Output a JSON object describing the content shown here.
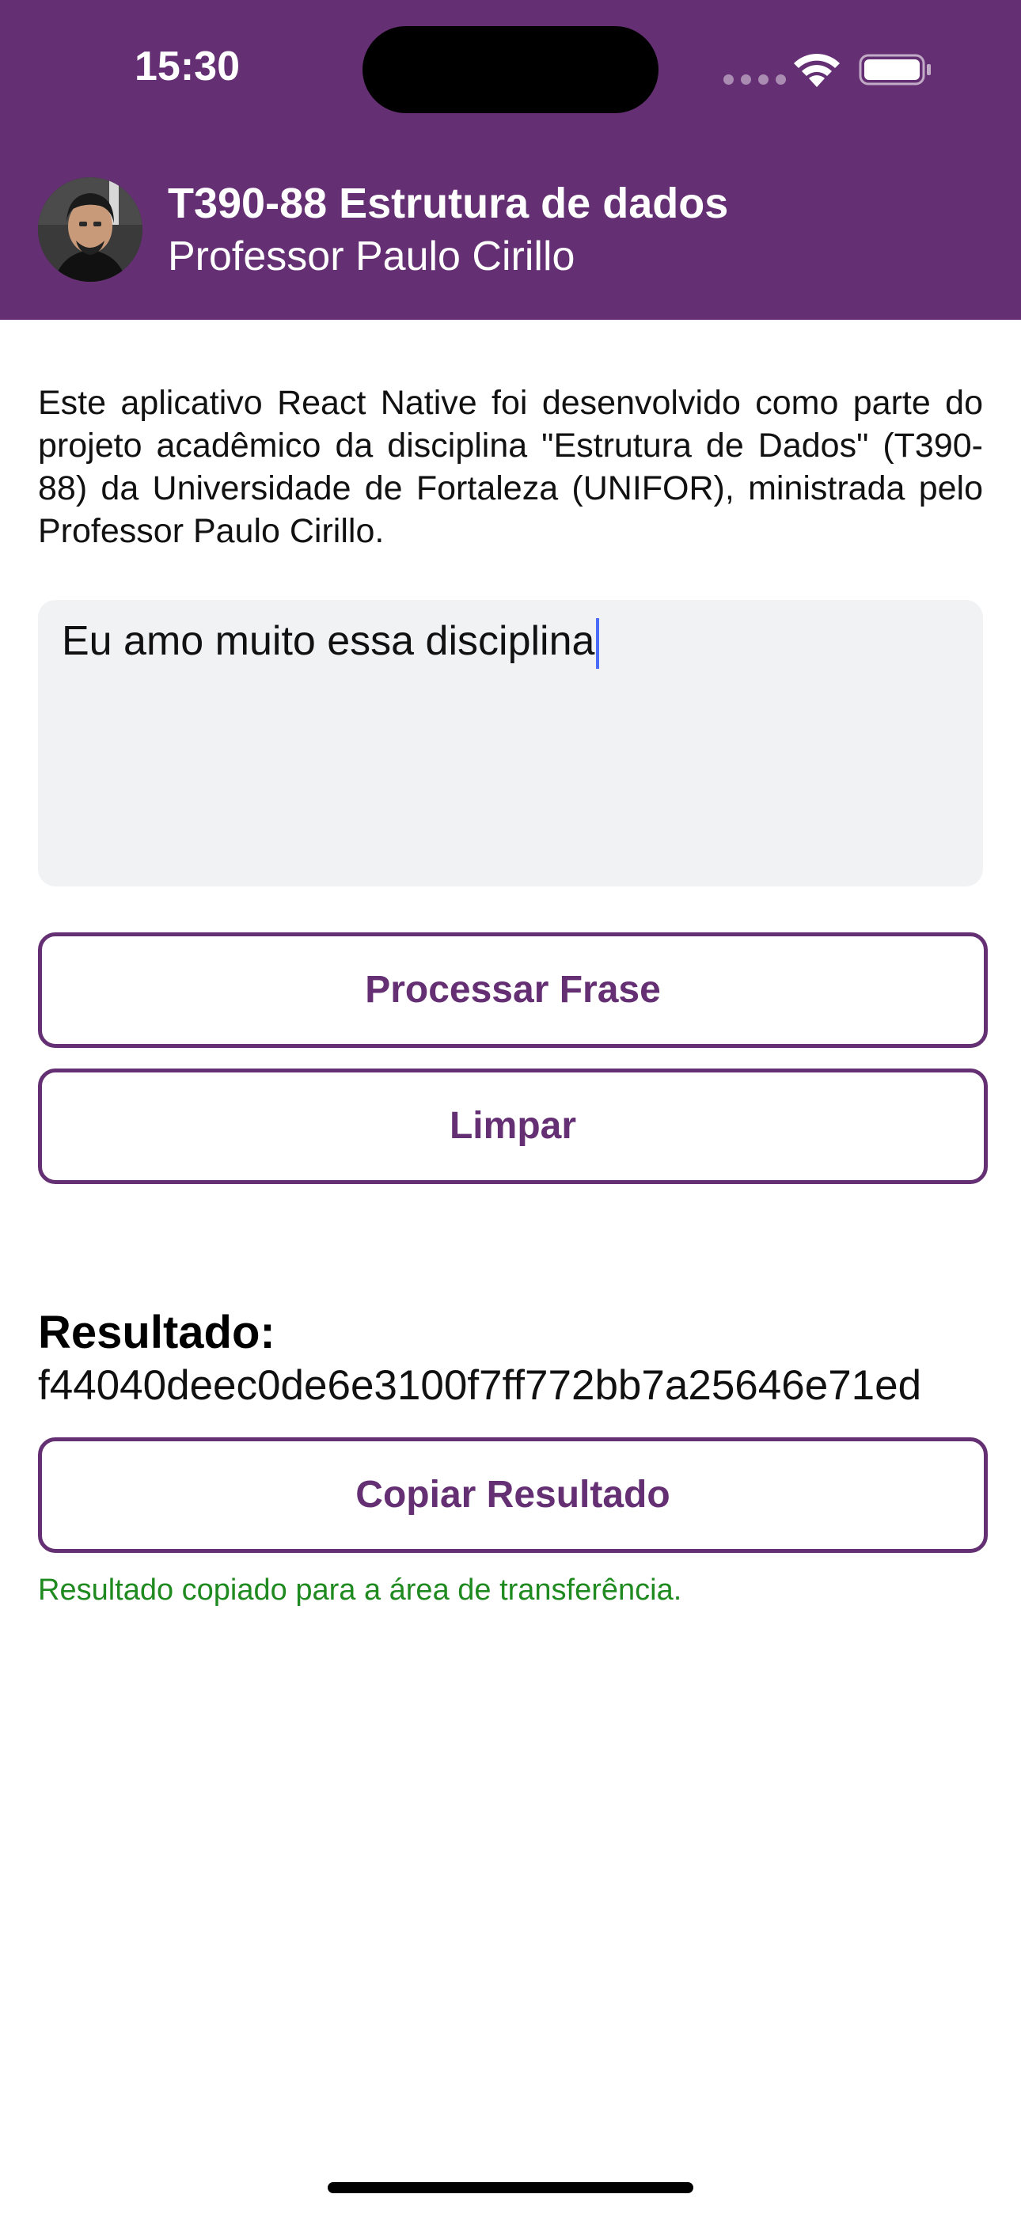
{
  "status_bar": {
    "time": "15:30"
  },
  "header": {
    "title": "T390-88 Estrutura de dados",
    "subtitle": "Professor Paulo Cirillo",
    "avatar": "professor-avatar"
  },
  "description": "Este aplicativo React Native foi desenvolvido como parte do projeto acadêmico da disciplina \"Estrutura de Dados\" (T390-88) da Universidade de Fortaleza (UNIFOR), ministrada pelo Professor Paulo Cirillo.",
  "input": {
    "value": "Eu amo muito essa disciplina"
  },
  "buttons": {
    "process": "Processar Frase",
    "clear": "Limpar",
    "copy": "Copiar Resultado"
  },
  "result": {
    "label": "Resultado:",
    "value": "f44040deec0de6e3100f7ff772bb7a25646e71ed"
  },
  "copy_status": "Resultado copiado para a área de transferência.",
  "colors": {
    "primary": "#652f73",
    "success": "#1f8a1f",
    "input_background": "#f1f2f4"
  },
  "icons": [
    "wifi-icon",
    "battery-icon",
    "cellular-signal-icon"
  ]
}
